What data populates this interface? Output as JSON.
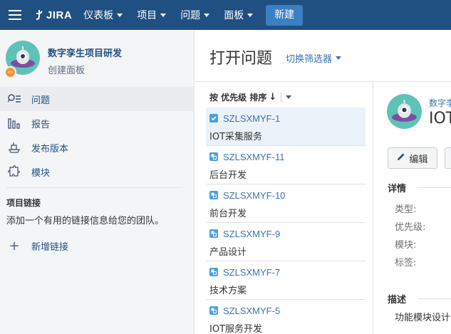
{
  "nav": {
    "logo_text": "JIRA",
    "items": [
      {
        "label": "仪表板"
      },
      {
        "label": "项目"
      },
      {
        "label": "问题"
      },
      {
        "label": "面板"
      }
    ],
    "create_label": "新建",
    "bg_color": "#205081"
  },
  "sidebar": {
    "project_name": "数字孪生项目研发",
    "project_sub": "创建面板",
    "items": [
      {
        "label": "问题",
        "icon": "issues-icon",
        "active": true
      },
      {
        "label": "报告",
        "icon": "reports-icon"
      },
      {
        "label": "发布版本",
        "icon": "releases-icon"
      },
      {
        "label": "模块",
        "icon": "components-icon"
      }
    ],
    "links_heading": "项目链接",
    "links_hint": "添加一个有用的链接信息给您的团队。",
    "add_link_label": "新增链接"
  },
  "main": {
    "title": "打开问题",
    "switch_filter_label": "切换筛选器",
    "sort_label": "按 优先级 排序",
    "issues": [
      {
        "key": "SZLSXMYF-1",
        "summary": "IOT采集服务",
        "type": "task",
        "selected": true
      },
      {
        "key": "SZLSXMYF-11",
        "summary": "后台开发",
        "type": "subtask"
      },
      {
        "key": "SZLSXMYF-10",
        "summary": "前台开发",
        "type": "subtask"
      },
      {
        "key": "SZLSXMYF-9",
        "summary": "产品设计",
        "type": "subtask"
      },
      {
        "key": "SZLSXMYF-7",
        "summary": "技术方案",
        "type": "subtask"
      },
      {
        "key": "SZLSXMYF-5",
        "summary": "IOT服务开发",
        "type": "subtask"
      }
    ]
  },
  "detail": {
    "project_name": "数字李",
    "issue_key": "IOT",
    "edit_label": "编辑",
    "details_heading": "详情",
    "fields": [
      "类型:",
      "优先级:",
      "模块:",
      "标签:"
    ],
    "description_heading": "描述",
    "description_text": "功能模块设计"
  }
}
